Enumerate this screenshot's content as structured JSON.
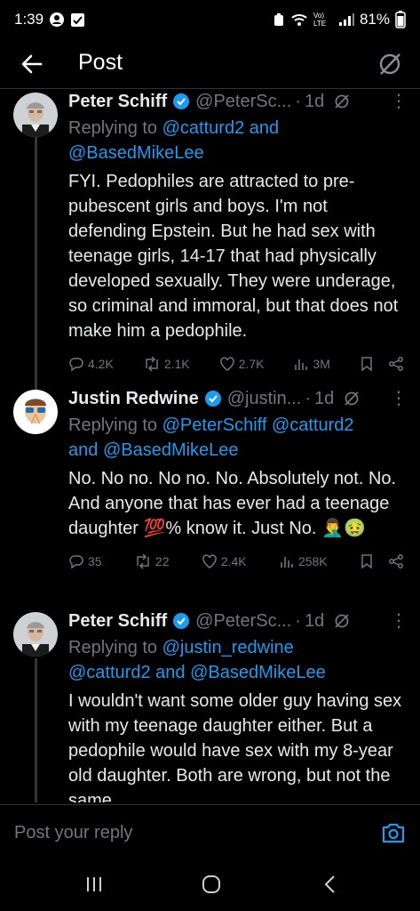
{
  "status": {
    "time": "1:39",
    "network": "Vo) LTE",
    "battery": "81%"
  },
  "header": {
    "title": "Post"
  },
  "tweets": [
    {
      "name": "Peter Schiff",
      "handle": "@PeterSc...",
      "dot": "·",
      "time": "1d",
      "replying_prefix": "Replying to",
      "mentions_line1": "@catturd2",
      "and1": "and",
      "mentions_line2": "@BasedMikeLee",
      "body": "FYI. Pedophiles are attracted to pre-pubescent girls and boys.  I'm not defending Epstein. But he had sex with teenage girls, 14-17 that had physically developed sexually. They were underage, so criminal and immoral, but that does not make him a pedophile.",
      "replies": "4.2K",
      "reposts": "2.1K",
      "likes": "2.7K",
      "views": "3M"
    },
    {
      "name": "Justin Redwine",
      "handle": "@justin...",
      "dot": "·",
      "time": "1d",
      "replying_prefix": "Replying to",
      "mention_a": "@PeterSchiff",
      "mention_b": "@catturd2",
      "and1": "and",
      "mention_c": "@BasedMikeLee",
      "body_1": "No. No no. No no. No. Absolutely not. No. And anyone that has ever had a teenage daughter ",
      "emoji_100": "💯",
      "body_2": "%  know it. Just No. ",
      "emoji_end": "🤦‍♂️🤢",
      "replies": "35",
      "reposts": "22",
      "likes": "2.4K",
      "views": "258K"
    },
    {
      "name": "Peter Schiff",
      "handle": "@PeterSc...",
      "dot": "·",
      "time": "1d",
      "replying_prefix": "Replying to",
      "mention_a": "@justin_redwine",
      "mention_b": "@catturd2",
      "and1": "and",
      "mention_c": "@BasedMikeLee",
      "body": "I wouldn't want some older guy having sex with my teenage daughter either. But a pedophile would have sex with my 8-year old daughter. Both are wrong, but not the same."
    }
  ],
  "composer": {
    "placeholder": "Post your reply"
  },
  "colors": {
    "accent": "#1d9bf0",
    "muted": "#71767b",
    "text": "#e7e9ea",
    "background": "#000000"
  }
}
